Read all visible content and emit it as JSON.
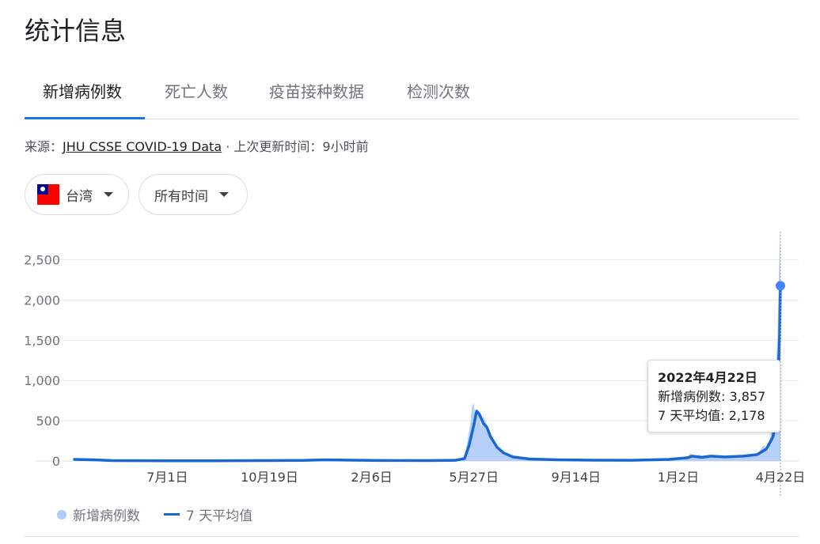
{
  "header": {
    "title": "统计信息"
  },
  "tabs": [
    {
      "label": "新增病例数",
      "active": true
    },
    {
      "label": "死亡人数",
      "active": false
    },
    {
      "label": "疫苗接种数据",
      "active": false
    },
    {
      "label": "检测次数",
      "active": false
    }
  ],
  "source": {
    "prefix": "来源：",
    "link": "JHU CSSE COVID-19 Data",
    "suffix": " · 上次更新时间：9小时前"
  },
  "filters": {
    "region": "台湾",
    "time_range": "所有时间"
  },
  "tooltip": {
    "date": "2022年4月22日",
    "cases": "新增病例数: 3,857",
    "avg": "7 天平均值: 2,178"
  },
  "legend": {
    "bars": "新增病例数",
    "line": "7 天平均值"
  },
  "colors": {
    "accent": "#1a73e8",
    "bars": "#aecbfa",
    "line": "#1967d2",
    "grid": "#e8eaed"
  },
  "chart_data": {
    "type": "area",
    "ylim": [
      0,
      2850
    ],
    "yticks": [
      0,
      500,
      1000,
      1500,
      2000,
      2500
    ],
    "ytick_labels": [
      "0",
      "500",
      "1,000",
      "1,500",
      "2,000",
      "2,500"
    ],
    "xtick_labels": [
      "7月1日",
      "10月19日",
      "2月6日",
      "5月27日",
      "9月14日",
      "1月2日",
      "4月22日"
    ],
    "xtick_days": [
      100,
      210,
      320,
      430,
      540,
      650,
      760
    ],
    "x_domain": [
      0,
      760
    ],
    "series": [
      {
        "name": "7 天平均值",
        "points": [
          [
            0,
            20
          ],
          [
            20,
            15
          ],
          [
            40,
            5
          ],
          [
            100,
            2
          ],
          [
            150,
            3
          ],
          [
            200,
            5
          ],
          [
            250,
            8
          ],
          [
            270,
            15
          ],
          [
            300,
            10
          ],
          [
            330,
            6
          ],
          [
            380,
            5
          ],
          [
            410,
            8
          ],
          [
            420,
            30
          ],
          [
            425,
            200
          ],
          [
            430,
            450
          ],
          [
            433,
            620
          ],
          [
            436,
            580
          ],
          [
            440,
            470
          ],
          [
            444,
            420
          ],
          [
            448,
            300
          ],
          [
            455,
            170
          ],
          [
            462,
            100
          ],
          [
            472,
            50
          ],
          [
            490,
            25
          ],
          [
            520,
            15
          ],
          [
            560,
            10
          ],
          [
            600,
            8
          ],
          [
            640,
            20
          ],
          [
            660,
            40
          ],
          [
            665,
            60
          ],
          [
            675,
            45
          ],
          [
            685,
            60
          ],
          [
            700,
            50
          ],
          [
            720,
            60
          ],
          [
            735,
            80
          ],
          [
            745,
            150
          ],
          [
            752,
            300
          ],
          [
            755,
            500
          ],
          [
            757,
            900
          ],
          [
            759,
            1500
          ],
          [
            760,
            2178
          ]
        ]
      },
      {
        "name": "新增病例数",
        "points": [
          [
            0,
            20
          ],
          [
            20,
            15
          ],
          [
            40,
            5
          ],
          [
            100,
            2
          ],
          [
            150,
            3
          ],
          [
            200,
            5
          ],
          [
            250,
            8
          ],
          [
            270,
            15
          ],
          [
            300,
            10
          ],
          [
            330,
            6
          ],
          [
            380,
            5
          ],
          [
            410,
            8
          ],
          [
            420,
            40
          ],
          [
            423,
            250
          ],
          [
            426,
            450
          ],
          [
            428,
            680
          ],
          [
            430,
            720
          ],
          [
            432,
            500
          ],
          [
            434,
            600
          ],
          [
            436,
            550
          ],
          [
            438,
            420
          ],
          [
            440,
            560
          ],
          [
            443,
            480
          ],
          [
            446,
            380
          ],
          [
            450,
            250
          ],
          [
            455,
            160
          ],
          [
            462,
            90
          ],
          [
            472,
            50
          ],
          [
            490,
            25
          ],
          [
            520,
            15
          ],
          [
            560,
            10
          ],
          [
            600,
            8
          ],
          [
            640,
            20
          ],
          [
            660,
            40
          ],
          [
            663,
            100
          ],
          [
            667,
            50
          ],
          [
            672,
            80
          ],
          [
            680,
            40
          ],
          [
            690,
            70
          ],
          [
            700,
            50
          ],
          [
            720,
            60
          ],
          [
            735,
            80
          ],
          [
            742,
            200
          ],
          [
            747,
            120
          ],
          [
            750,
            380
          ],
          [
            753,
            700
          ],
          [
            755,
            1100
          ],
          [
            757,
            1600
          ],
          [
            758,
            2200
          ],
          [
            759,
            2600
          ],
          [
            760,
            3857
          ]
        ]
      }
    ],
    "highlight": {
      "x": 760,
      "value": 2178
    }
  }
}
